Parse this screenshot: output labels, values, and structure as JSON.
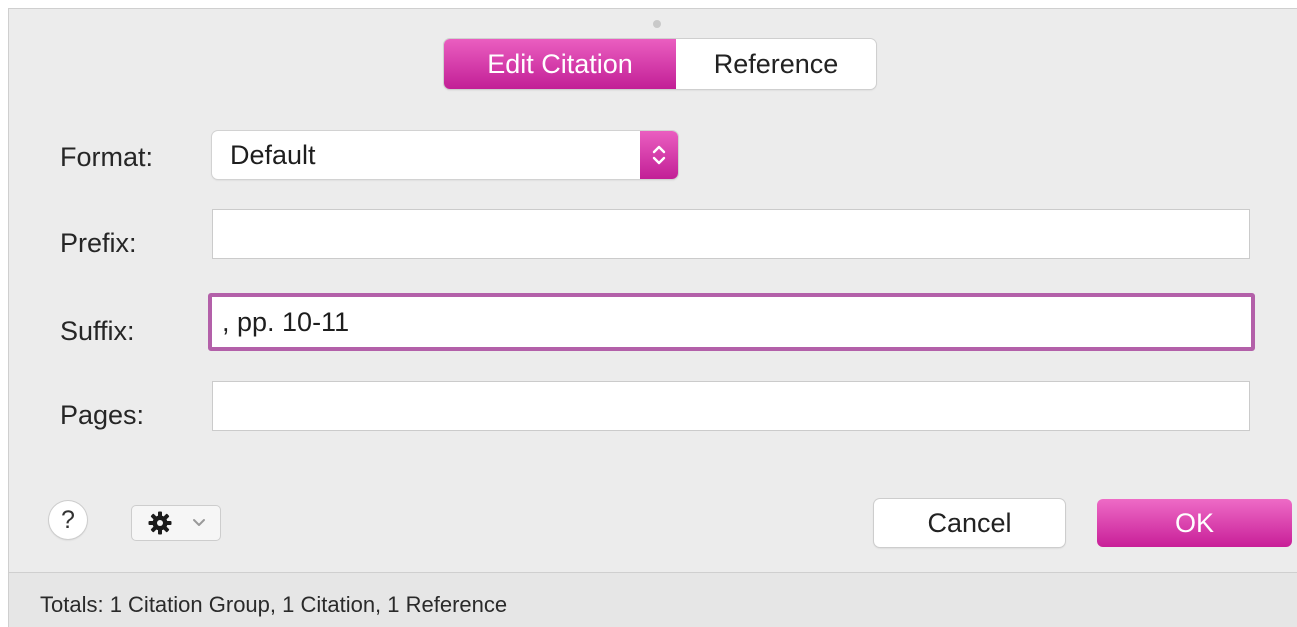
{
  "tabs": [
    {
      "label": "Edit Citation",
      "active": true
    },
    {
      "label": "Reference",
      "active": false
    }
  ],
  "form": {
    "format_label": "Format:",
    "format_value": "Default",
    "prefix_label": "Prefix:",
    "prefix_value": "",
    "suffix_label": "Suffix:",
    "suffix_value": ", pp. 10-11",
    "pages_label": "Pages:",
    "pages_value": ""
  },
  "footer": {
    "help_label": "?",
    "cancel_label": "Cancel",
    "ok_label": "OK"
  },
  "status": {
    "text": "Totals: 1 Citation Group, 1 Citation, 1 Reference"
  },
  "icons": {
    "help": "question-mark-icon",
    "gear": "gear-icon",
    "gear_menu": "chevron-down-icon",
    "format_popup": "up-down-arrows-icon"
  },
  "colors": {
    "accent": "#c8289f",
    "focus_ring": "#b360a9"
  }
}
